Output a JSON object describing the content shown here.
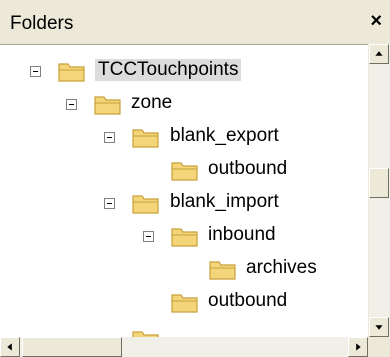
{
  "panel": {
    "title": "Folders",
    "close_label": "×"
  },
  "tree": [
    {
      "label": "TCCTouchpoints",
      "level": 0,
      "expander": "minus",
      "selected": true
    },
    {
      "label": "zone",
      "level": 1,
      "expander": "minus"
    },
    {
      "label": "blank_export",
      "level": 2,
      "expander": "minus"
    },
    {
      "label": "outbound",
      "level": 3,
      "expander": "none"
    },
    {
      "label": "blank_import",
      "level": 2,
      "expander": "minus"
    },
    {
      "label": "inbound",
      "level": 3,
      "expander": "minus"
    },
    {
      "label": "archives",
      "level": 4,
      "expander": "none"
    },
    {
      "label": "outbound",
      "level": 3,
      "expander": "none"
    }
  ],
  "colors": {
    "folder_fill": "#f5d57a",
    "folder_stroke": "#c8a13a",
    "selection": "#dcdcdc"
  }
}
